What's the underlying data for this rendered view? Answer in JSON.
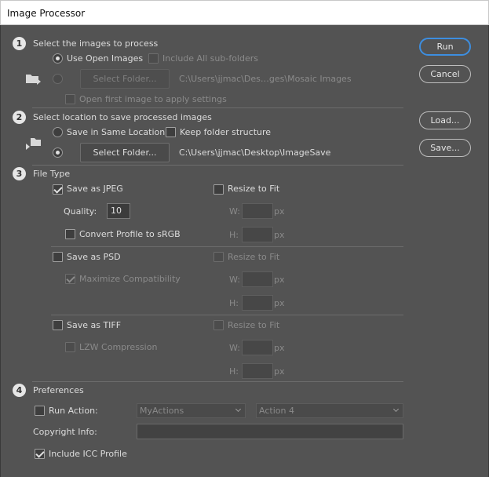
{
  "window": {
    "title": "Image Processor"
  },
  "buttons": {
    "run": "Run",
    "cancel": "Cancel",
    "load": "Load...",
    "save": "Save..."
  },
  "section1": {
    "number": "1",
    "title": "Select the images to process",
    "use_open_images": "Use Open Images",
    "include_subfolders": "Include All sub-folders",
    "select_folder": "Select Folder...",
    "source_path": "C:\\Users\\jjmac\\Des…ges\\Mosaic Images",
    "open_first_image": "Open first image to apply settings"
  },
  "section2": {
    "number": "2",
    "title": "Select location to save processed images",
    "save_same_location": "Save in Same Location",
    "keep_folder_structure": "Keep folder structure",
    "select_folder": "Select Folder...",
    "dest_path": "C:\\Users\\jjmac\\Desktop\\ImageSave"
  },
  "section3": {
    "number": "3",
    "title": "File Type",
    "jpeg": {
      "label": "Save as JPEG",
      "quality_label": "Quality:",
      "quality_value": "10",
      "convert_profile": "Convert Profile to sRGB",
      "resize": "Resize to Fit",
      "w_label": "W:",
      "h_label": "H:",
      "unit": "px"
    },
    "psd": {
      "label": "Save as PSD",
      "maximize": "Maximize Compatibility",
      "resize": "Resize to Fit",
      "w_label": "W:",
      "h_label": "H:",
      "unit": "px"
    },
    "tiff": {
      "label": "Save as TIFF",
      "lzw": "LZW Compression",
      "resize": "Resize to Fit",
      "w_label": "W:",
      "h_label": "H:",
      "unit": "px"
    }
  },
  "section4": {
    "number": "4",
    "title": "Preferences",
    "run_action": "Run Action:",
    "action_set": "MyActions",
    "action": "Action 4",
    "copyright_label": "Copyright Info:",
    "copyright_value": "",
    "include_icc": "Include ICC Profile"
  }
}
